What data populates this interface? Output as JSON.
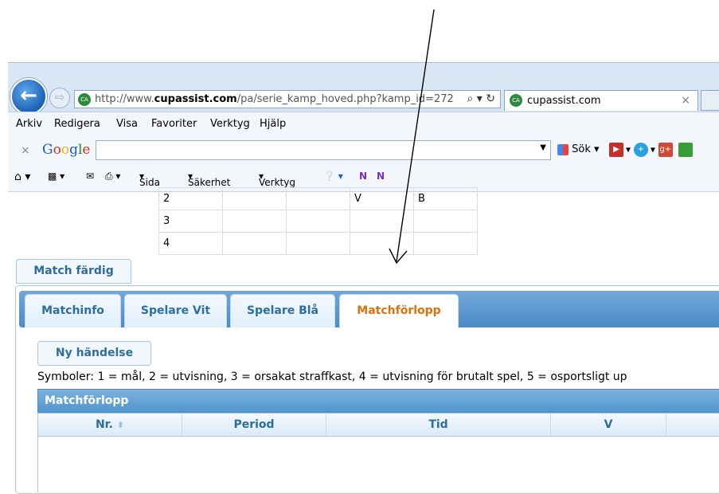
{
  "browser": {
    "url_prefix": "http://www.",
    "url_domain": "cupassist.com",
    "url_path": "/pa/serie_kamp_hoved.php?kamp_id=272",
    "address_controls": "⌕ ▾ ↻",
    "tab_title": "cupassist.com",
    "tab_close": "×",
    "site_badge": "CA",
    "menu": [
      "Arkiv",
      "Redigera",
      "Visa",
      "Favoriter",
      "Verktyg",
      "Hjälp"
    ],
    "google_label": "Google",
    "google_close": "×",
    "sok_label": "Sök",
    "cmd_items": [
      "Sida",
      "Säkerhet",
      "Verktyg"
    ],
    "icons": [
      "back-icon",
      "forward-icon",
      "home-icon",
      "feed-icon",
      "mail-icon",
      "print-icon",
      "help-icon",
      "search-icon",
      "refresh-icon",
      "youtube-icon",
      "googleplus-icon"
    ]
  },
  "mini_table": {
    "rows": [
      [
        "2",
        "",
        "",
        "V",
        "B"
      ],
      [
        "3",
        "",
        "",
        "",
        ""
      ],
      [
        "4",
        "",
        "",
        "",
        ""
      ]
    ]
  },
  "match_done_label": "Match färdig",
  "tabs": [
    "Matchinfo",
    "Spelare Vit",
    "Spelare Blå",
    "Matchförlopp"
  ],
  "active_tab": "Matchförlopp",
  "new_event_label": "Ny händelse",
  "symbols_text": "Symboler: 1 = mål, 2 = utvisning, 3 = orsakat straffkast, 4 = utvisning för brutalt spel, 5 = osportsligt up",
  "grid": {
    "title": "Matchförlopp",
    "columns": [
      "Nr.",
      "Period",
      "Tid",
      "V"
    ],
    "sort_icon": "⬍"
  },
  "colors": {
    "tab_active_text": "#e17009",
    "tab_text": "#2e6e9e",
    "header_blue": "#5294cf"
  }
}
